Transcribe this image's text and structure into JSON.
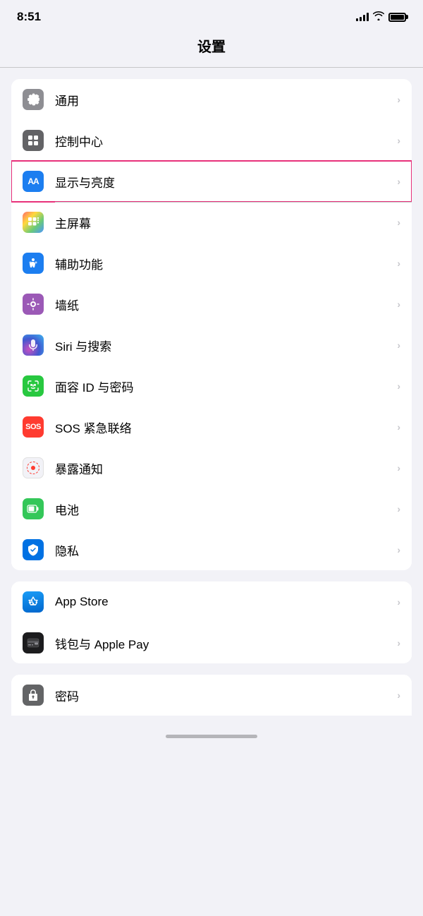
{
  "statusBar": {
    "time": "8:51",
    "signalLabel": "signal",
    "wifiLabel": "wifi",
    "batteryLabel": "battery"
  },
  "pageTitle": "设置",
  "sections": [
    {
      "id": "section1",
      "highlighted": false,
      "items": [
        {
          "id": "general",
          "label": "通用",
          "iconType": "gear",
          "iconBg": "bg-gray",
          "iconText": "⚙️"
        },
        {
          "id": "control",
          "label": "控制中心",
          "iconType": "control",
          "iconBg": "bg-gray2",
          "iconText": "⊞"
        },
        {
          "id": "display",
          "label": "显示与亮度",
          "iconType": "aa",
          "iconBg": "bg-blue",
          "iconText": "AA",
          "highlighted": true
        },
        {
          "id": "homescreen",
          "label": "主屏幕",
          "iconType": "grid",
          "iconBg": "bg-colorful",
          "iconText": "⊞"
        },
        {
          "id": "accessibility",
          "label": "辅助功能",
          "iconType": "person",
          "iconBg": "bg-blue2",
          "iconText": "♿"
        },
        {
          "id": "wallpaper",
          "label": "墙纸",
          "iconType": "flower",
          "iconBg": "bg-purple",
          "iconText": "✿"
        },
        {
          "id": "siri",
          "label": "Siri 与搜索",
          "iconType": "siri",
          "iconBg": "siri-icon",
          "iconText": ""
        },
        {
          "id": "faceid",
          "label": "面容 ID 与密码",
          "iconType": "faceid",
          "iconBg": "bg-green2",
          "iconText": "🙂"
        },
        {
          "id": "sos",
          "label": "SOS 紧急联络",
          "iconType": "sos",
          "iconBg": "bg-red2",
          "iconText": "SOS"
        },
        {
          "id": "exposure",
          "label": "暴露通知",
          "iconType": "exposure",
          "iconBg": "exposure-icon",
          "iconText": ""
        },
        {
          "id": "battery",
          "label": "电池",
          "iconType": "battery",
          "iconBg": "bg-green",
          "iconText": "🔋"
        },
        {
          "id": "privacy",
          "label": "隐私",
          "iconType": "hand",
          "iconBg": "bg-blue3",
          "iconText": "✋"
        }
      ]
    },
    {
      "id": "section2",
      "highlighted": false,
      "items": [
        {
          "id": "appstore",
          "label": "App Store",
          "iconType": "appstore",
          "iconBg": "appstore-icon",
          "iconText": "A"
        },
        {
          "id": "wallet",
          "label": "钱包与 Apple Pay",
          "iconType": "wallet",
          "iconBg": "wallet-icon",
          "iconText": "💳"
        }
      ]
    },
    {
      "id": "section3",
      "highlighted": false,
      "partial": true,
      "items": [
        {
          "id": "password",
          "label": "密码",
          "iconType": "password",
          "iconBg": "bg-gray2",
          "iconText": "🔑"
        }
      ]
    }
  ]
}
